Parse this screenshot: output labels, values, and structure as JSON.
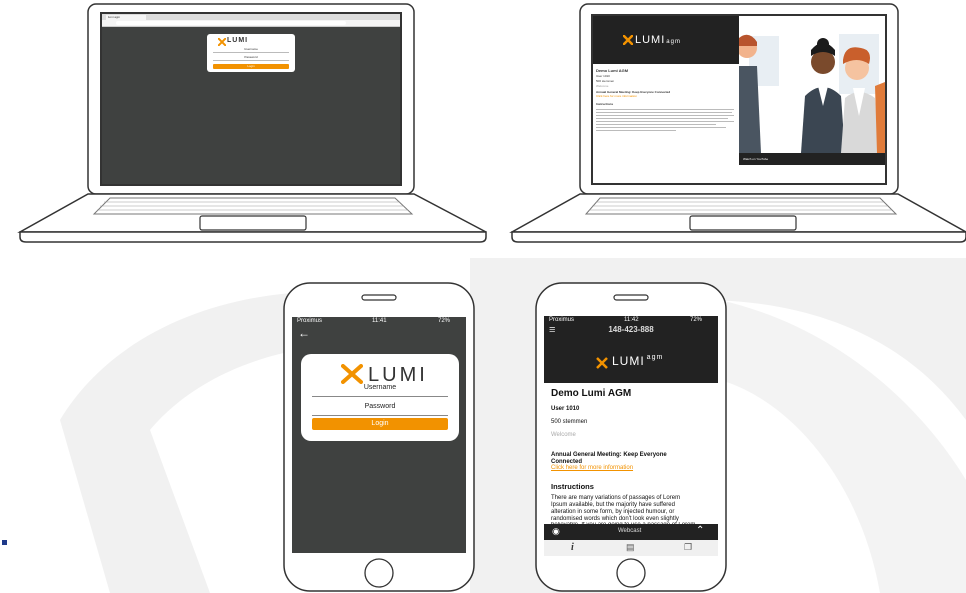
{
  "laptop_login": {
    "tab_title": "lumi agm",
    "logo": "LUMI",
    "username_label": "Username",
    "password_label": "Password",
    "login_label": "Login"
  },
  "laptop_meeting": {
    "logo": "LUMI",
    "logo_suffix": "agm",
    "meeting_title": "Demo Lumi AGM",
    "user": "User 1010",
    "votes": "500 stemmen",
    "welcome": "Welcome",
    "announcement": "Annual General Meeting: Keep Everyone Connected",
    "link": "Click here for more information",
    "instructions_heading": "Instructions",
    "video_caption": "Watch on YouTube"
  },
  "phone_login": {
    "carrier": "Proximus",
    "time": "11:41",
    "battery": "72%",
    "logo": "LUMI",
    "username_label": "Username",
    "password_label": "Password",
    "login_label": "Login"
  },
  "phone_meeting": {
    "carrier": "Proximus",
    "time": "11:42",
    "battery": "72%",
    "meeting_id": "148-423-888",
    "logo": "LUMI",
    "logo_suffix": "agm",
    "meeting_title": "Demo Lumi AGM",
    "user": "User 1010",
    "votes": "500 stemmen",
    "welcome": "Welcome",
    "announcement_line1": "Annual General Meeting: Keep Everyone",
    "announcement_line2": "Connected",
    "link": "Click here for more information",
    "instructions_heading": "Instructions",
    "instructions_lines": [
      "There are many variations of passages of Lorem",
      "Ipsum available, but the majority have suffered",
      "alteration in some form, by injected humour, or",
      "randomised words which don't look even slightly",
      "believable. If you are going to use a passage of Lorem"
    ],
    "webcast_label": "Webcast"
  },
  "colors": {
    "accent": "#f29200",
    "screen_dark": "#3f4140",
    "header_dark": "#222222"
  }
}
